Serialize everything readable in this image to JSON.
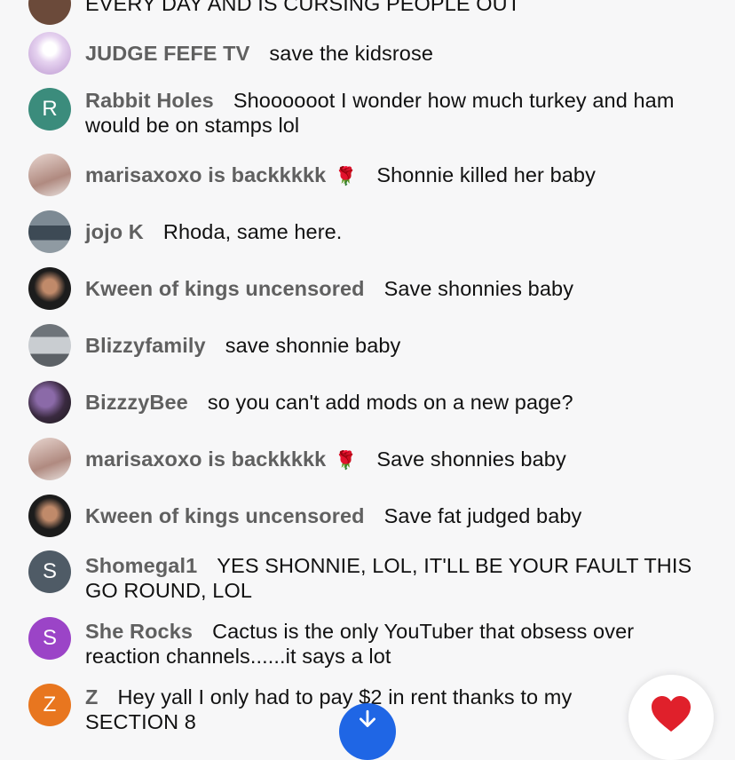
{
  "messages": [
    {
      "author": "",
      "emoji": "",
      "text": "EVERY DAY AND IS CURSING PEOPLE OUT",
      "avatar_letter": "",
      "avatar_color": "#6b4a3a"
    },
    {
      "author": "JUDGE FEFE TV",
      "emoji": "",
      "text": "save the kidsrose",
      "avatar_letter": "",
      "avatar_color": "#d6c1e6"
    },
    {
      "author": "Rabbit Holes",
      "emoji": "",
      "text": "Shoooooot I wonder how much turkey and ham would be on stamps lol",
      "avatar_letter": "R",
      "avatar_color": "#3b8c7c"
    },
    {
      "author": "marisaxoxo is backkkkk",
      "emoji": "🌹",
      "text": "Shonnie killed her baby",
      "avatar_letter": "",
      "avatar_color": "#c9a8a0"
    },
    {
      "author": "jojo K",
      "emoji": "",
      "text": "Rhoda, same here.",
      "avatar_letter": "",
      "avatar_color": "#51606c"
    },
    {
      "author": "Kween of kings uncensored",
      "emoji": "",
      "text": "Save shonnies baby",
      "avatar_letter": "",
      "avatar_color": "#2a2a2a"
    },
    {
      "author": "Blizzyfamily",
      "emoji": "",
      "text": "save shonnie baby",
      "avatar_letter": "",
      "avatar_color": "#9aa0a6"
    },
    {
      "author": "BizzzyBee",
      "emoji": "",
      "text": "so you can't add mods on a new page?",
      "avatar_letter": "",
      "avatar_color": "#4a3a52"
    },
    {
      "author": "marisaxoxo is backkkkk",
      "emoji": "🌹",
      "text": "Save shonnies baby",
      "avatar_letter": "",
      "avatar_color": "#c9a8a0"
    },
    {
      "author": "Kween of kings uncensored",
      "emoji": "",
      "text": "Save fat judged baby",
      "avatar_letter": "",
      "avatar_color": "#2a2a2a"
    },
    {
      "author": "Shomegal1",
      "emoji": "",
      "text": "YES SHONNIE, LOL, IT'LL BE YOUR FAULT THIS GO ROUND, LOL",
      "avatar_letter": "S",
      "avatar_color": "#4f5b66"
    },
    {
      "author": "She Rocks",
      "emoji": "",
      "text": "Cactus is the only YouTuber that obsess over reaction channels......it says a lot",
      "avatar_letter": "S",
      "avatar_color": "#9b44c7"
    },
    {
      "author": "Z",
      "emoji": "",
      "text": "Hey yall I only had to pay $2 in rent thanks to my SECTION 8",
      "avatar_letter": "Z",
      "avatar_color": "#e8761f"
    }
  ],
  "controls": {
    "scroll_down_icon": "arrow-down-icon",
    "heart_icon": "heart-icon",
    "heart_color": "#e0202b",
    "fab_color": "#1f66e5"
  }
}
